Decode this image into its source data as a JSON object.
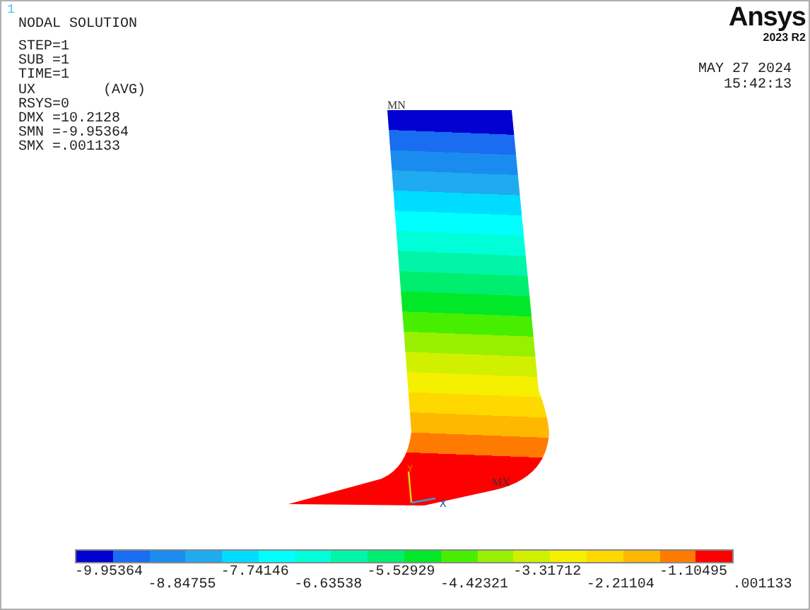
{
  "window": {
    "number": "1"
  },
  "info": {
    "title": "NODAL SOLUTION",
    "lines": [
      "STEP=1",
      "SUB =1",
      "TIME=1",
      "UX        (AVG)",
      "RSYS=0",
      "DMX =10.2128",
      "SMN =-9.95364",
      "SMX =.001133"
    ]
  },
  "brand": {
    "logo": "Ansys",
    "version": "2023 R2"
  },
  "timestamp": {
    "date": "MAY 27 2024",
    "time": "15:42:13"
  },
  "plot": {
    "min_label": "MN",
    "max_label": "MX",
    "axis_labels": [
      "Y",
      "X"
    ]
  },
  "legend": {
    "bands": [
      {
        "color": "#0000d0"
      },
      {
        "color": "#1a6cf0"
      },
      {
        "color": "#1a8cf0"
      },
      {
        "color": "#20aaf0"
      },
      {
        "color": "#00dcff"
      },
      {
        "color": "#00ffff"
      },
      {
        "color": "#00ffd8"
      },
      {
        "color": "#00f5a8"
      },
      {
        "color": "#00ee70"
      },
      {
        "color": "#00e828"
      },
      {
        "color": "#48ee00"
      },
      {
        "color": "#98f000"
      },
      {
        "color": "#d0f000"
      },
      {
        "color": "#f4f000"
      },
      {
        "color": "#ffd800"
      },
      {
        "color": "#ffb800"
      },
      {
        "color": "#ff7a00"
      },
      {
        "color": "#ff0000"
      }
    ],
    "labels": [
      "-9.95364",
      "-8.84755",
      "-7.74146",
      "-6.63538",
      "-5.52929",
      "-4.42321",
      "-3.31712",
      "-2.21104",
      "-1.10495",
      ".001133"
    ]
  }
}
